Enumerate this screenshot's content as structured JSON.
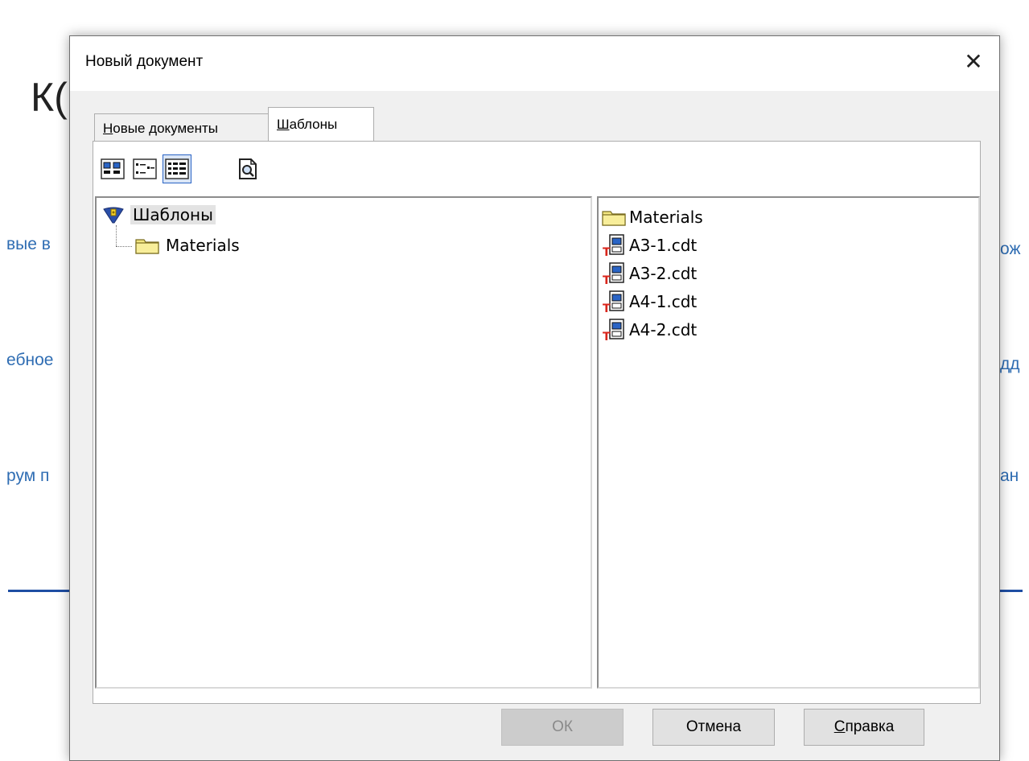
{
  "background": {
    "title_partial": "К(",
    "left_snippets": [
      "вые в",
      "ебное",
      "рум п"
    ],
    "right_snippets": [
      "ож",
      "дд",
      "ан"
    ]
  },
  "dialog": {
    "title": "Новый документ",
    "close_glyph": "✕"
  },
  "tabs": [
    {
      "mnemonic": "Н",
      "rest": "овые документы"
    },
    {
      "mnemonic": "Ш",
      "rest": "аблоны"
    }
  ],
  "toolbar": {
    "buttons": [
      "large-icons",
      "list",
      "details",
      "preview"
    ],
    "active": "details"
  },
  "tree": {
    "root": "Шаблоны",
    "children": [
      "Materials"
    ]
  },
  "files": [
    {
      "name": "Materials",
      "type": "folder"
    },
    {
      "name": "А3-1.cdt",
      "type": "template"
    },
    {
      "name": "А3-2.cdt",
      "type": "template"
    },
    {
      "name": "А4-1.cdt",
      "type": "template"
    },
    {
      "name": "А4-2.cdt",
      "type": "template"
    }
  ],
  "buttons": {
    "ok": "ОК",
    "cancel": "Отмена",
    "help_mnemonic": "С",
    "help_rest": "правка"
  },
  "colors": {
    "link": "#2f6db3",
    "accent": "#2a64c5",
    "folder": "#f3e680"
  }
}
